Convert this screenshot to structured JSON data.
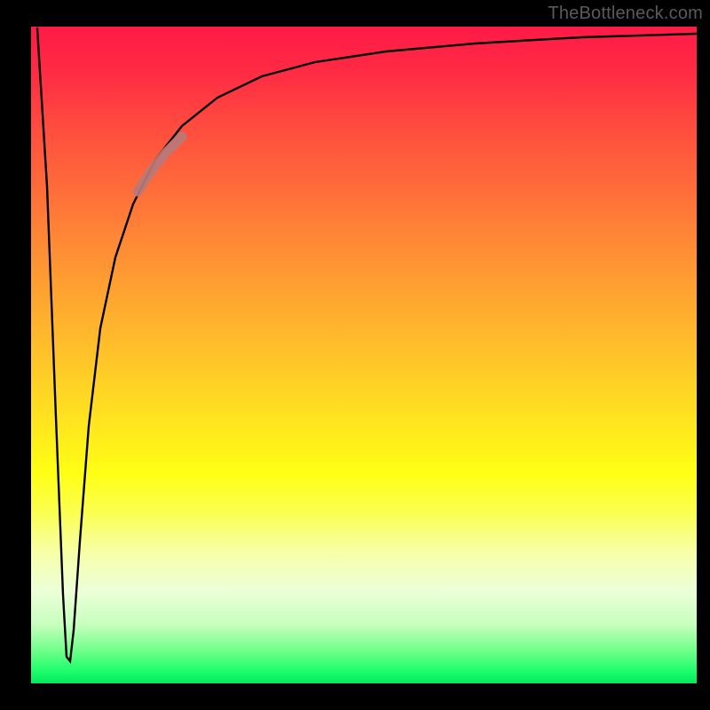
{
  "attribution": "TheBottleneck.com",
  "chart_data": {
    "type": "line",
    "title": "",
    "xlabel": "",
    "ylabel": "",
    "xlim": [
      0,
      100
    ],
    "ylim": [
      0,
      100
    ],
    "grid": false,
    "legend": false,
    "series": [
      {
        "name": "bottleneck-curve",
        "x": [
          0,
          1,
          2,
          3,
          4,
          5,
          6,
          8,
          10,
          12,
          15,
          18,
          22,
          27,
          35,
          45,
          60,
          80,
          100
        ],
        "y": [
          100,
          60,
          25,
          5,
          8,
          30,
          45,
          60,
          70,
          76,
          82,
          86,
          89,
          92,
          94,
          96,
          97.5,
          98.5,
          99
        ]
      }
    ],
    "highlight_region": {
      "x_start": 15,
      "x_end": 22
    },
    "background_gradient": {
      "top": "#ff1a46",
      "middle": "#ffff14",
      "bottom": "#05e85e"
    }
  },
  "colors": {
    "page_bg": "#000000",
    "curve": "#000000",
    "highlight": "#b87a7a",
    "watermark": "#5a5a5a"
  }
}
